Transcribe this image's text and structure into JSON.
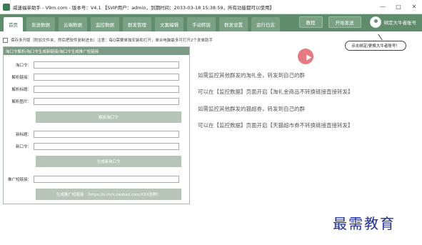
{
  "window": {
    "title": "威速福单助手 - V9m.com - 版本号：V4.1 【SVIP用户：admin，到期时间：2033-03-18 15:38:59，所有功能都可以使用】",
    "controls": [
      "—",
      "□",
      "✕"
    ]
  },
  "nav": {
    "tabs": [
      "首页",
      "发送数据",
      "云端数据",
      "监控数据",
      "群发管理",
      "文案编辑",
      "手动转链",
      "群发设置",
      "运行日志"
    ],
    "active_index": 0,
    "buttons": [
      "教程",
      "开始发送"
    ],
    "account_label": "绑定大牛者账号"
  },
  "tooltip": "点击绑定/更换大牛者账号！",
  "options": {
    "checkbox_label": "保存多开版（附加文件夹，然后把软件复制进去）注意：每Q需要单独安装和打开，单台电脑最多可打开2个发单助手"
  },
  "panel": {
    "header": "淘口令解析/淘口令生成新链接/淘口令生成推广短链接",
    "fields": [
      {
        "label": "淘口令：",
        "value": ""
      },
      {
        "label": "解析链接：",
        "value": ""
      },
      {
        "label": "解析标题：",
        "value": ""
      },
      {
        "label": "解析图片：",
        "value": ""
      }
    ],
    "parse_button": "解析淘口令",
    "gen_fields": [
      {
        "label": "新标题：",
        "value": ""
      },
      {
        "label": "新口令：",
        "value": ""
      }
    ],
    "gen_button": "生成新淘口令",
    "promo_field": {
      "label": "推广短链接：",
      "value": ""
    },
    "promo_button": "生成推广短链接 （https://s.click.taobao.com/XXX这种）"
  },
  "info_lines": [
    "如需监控其他群发的淘礼金，转发到自己的群",
    "可以在【监控数据】页面开启【淘礼金商品不转换链接直接转发】",
    "如需监控其他群发的猫超券，转发到自己的群",
    "可以在【监控数据】页面开启【天猫超市券不转换链接直接转发】"
  ],
  "watermark": "最需教育",
  "colors": {
    "nav_bg": "#5f8c6b",
    "panel_header": "#7c9986",
    "button_bg": "#b7c5b9",
    "cursor_highlight": "#e2636b",
    "watermark": "#1e2fa0"
  }
}
